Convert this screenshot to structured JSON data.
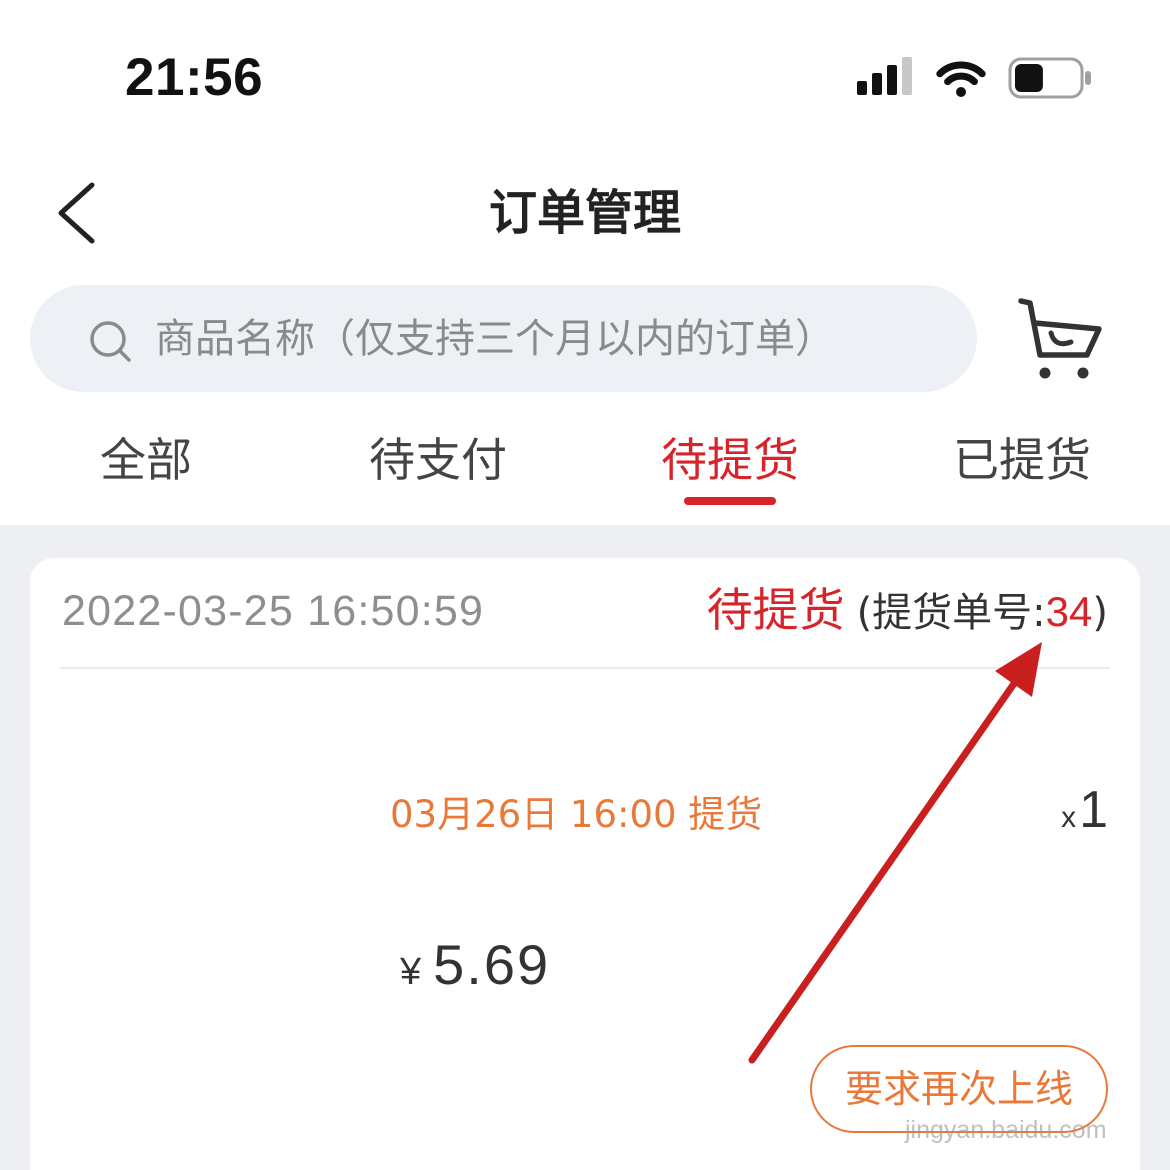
{
  "status_bar": {
    "time": "21:56",
    "signal_bars": 3,
    "signal_max": 4,
    "battery_level": 0.45,
    "icons": [
      "signal-icon",
      "wifi-icon",
      "battery-icon"
    ]
  },
  "nav": {
    "title": "订单管理",
    "back_icon": "chevron-left-icon"
  },
  "search": {
    "placeholder": "商品名称（仅支持三个月以内的订单）",
    "icon": "search-icon"
  },
  "cart": {
    "icon": "cart-icon"
  },
  "tabs": [
    {
      "label": "全部",
      "active": false
    },
    {
      "label": "待支付",
      "active": false
    },
    {
      "label": "待提货",
      "active": true
    },
    {
      "label": "已提货",
      "active": false
    }
  ],
  "order": {
    "created_at": "2022-03-25 16:50:59",
    "status": "待提货",
    "pickup_no_prefix": "(提货单号:",
    "pickup_no": "34",
    "pickup_no_suffix": ")",
    "pickup_time": "03月26日 16:00 提货",
    "qty_prefix": "x",
    "qty": "1",
    "currency": "¥",
    "price": "5.69",
    "action_label": "要求再次上线"
  },
  "watermark": "jingyan.baidu.com",
  "colors": {
    "accent_red": "#d8232a",
    "accent_orange": "#e8793a",
    "page_bg": "#edeff3",
    "search_bg": "#edf0f4",
    "annotation_red": "#c9201f"
  }
}
